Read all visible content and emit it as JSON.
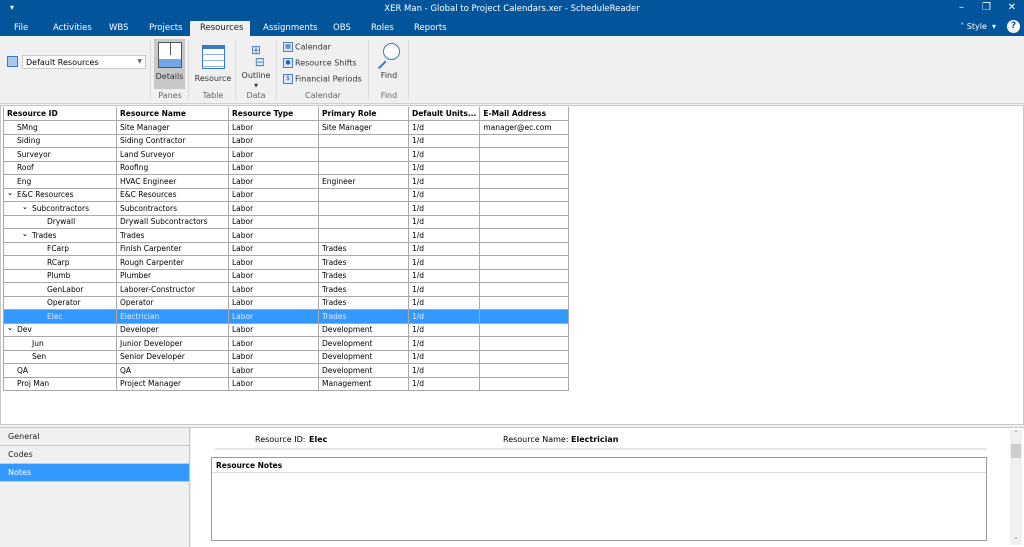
{
  "window": {
    "title": "XER Man - Global to Project Calendars.xer - ScheduleReader",
    "quick_access": "▾",
    "minimize": "–",
    "restore": "❐",
    "close": "✕"
  },
  "menu": {
    "tabs": [
      "File",
      "Activities",
      "WBS",
      "Projects",
      "Resources",
      "Assignments",
      "OBS",
      "Roles",
      "Reports"
    ],
    "active": "Resources",
    "style_label": "Style",
    "help": "?"
  },
  "ribbon": {
    "layout_select": "Default Resources",
    "panes": {
      "details": "Details",
      "group": "Panes"
    },
    "table": {
      "resource": "Resource",
      "group": "Table"
    },
    "data": {
      "outline": "Outline",
      "group": "Data"
    },
    "calendar": {
      "calendar": "Calendar",
      "shifts": "Resource Shifts",
      "financial": "Financial Periods",
      "group": "Calendar"
    },
    "find": {
      "find": "Find",
      "group": "Find"
    }
  },
  "grid": {
    "columns": [
      "Resource ID",
      "Resource Name",
      "Resource Type",
      "Primary Role",
      "Default Units...",
      "E-Mail Address"
    ],
    "rows": [
      {
        "level": 0,
        "exp": false,
        "id": "SMng",
        "name": "Site Manager",
        "type": "Labor",
        "role": "Site Manager",
        "units": "1/d",
        "email": "manager@ec.com"
      },
      {
        "level": 0,
        "exp": false,
        "id": "Siding",
        "name": "Siding Contractor",
        "type": "Labor",
        "role": "",
        "units": "1/d",
        "email": ""
      },
      {
        "level": 0,
        "exp": false,
        "id": "Surveyor",
        "name": "Land Surveyor",
        "type": "Labor",
        "role": "",
        "units": "1/d",
        "email": ""
      },
      {
        "level": 0,
        "exp": false,
        "id": "Roof",
        "name": "Roofing",
        "type": "Labor",
        "role": "",
        "units": "1/d",
        "email": ""
      },
      {
        "level": 0,
        "exp": false,
        "id": "Eng",
        "name": "HVAC Engineer",
        "type": "Labor",
        "role": "Engineer",
        "units": "1/d",
        "email": ""
      },
      {
        "level": 0,
        "exp": true,
        "id": "E&C Resources",
        "name": "E&C Resources",
        "type": "Labor",
        "role": "",
        "units": "1/d",
        "email": ""
      },
      {
        "level": 1,
        "exp": true,
        "id": "Subcontractors",
        "name": "Subcontractors",
        "type": "Labor",
        "role": "",
        "units": "1/d",
        "email": ""
      },
      {
        "level": 2,
        "exp": false,
        "id": "Drywall",
        "name": "Drywall Subcontractors",
        "type": "Labor",
        "role": "",
        "units": "1/d",
        "email": ""
      },
      {
        "level": 1,
        "exp": true,
        "id": "Trades",
        "name": "Trades",
        "type": "Labor",
        "role": "",
        "units": "1/d",
        "email": ""
      },
      {
        "level": 2,
        "exp": false,
        "id": "FCarp",
        "name": "Finish Carpenter",
        "type": "Labor",
        "role": "Trades",
        "units": "1/d",
        "email": ""
      },
      {
        "level": 2,
        "exp": false,
        "id": "RCarp",
        "name": "Rough Carpenter",
        "type": "Labor",
        "role": "Trades",
        "units": "1/d",
        "email": ""
      },
      {
        "level": 2,
        "exp": false,
        "id": "Plumb",
        "name": "Plumber",
        "type": "Labor",
        "role": "Trades",
        "units": "1/d",
        "email": ""
      },
      {
        "level": 2,
        "exp": false,
        "id": "GenLabor",
        "name": "Laborer-Constructor",
        "type": "Labor",
        "role": "Trades",
        "units": "1/d",
        "email": ""
      },
      {
        "level": 2,
        "exp": false,
        "id": "Operator",
        "name": "Operator",
        "type": "Labor",
        "role": "Trades",
        "units": "1/d",
        "email": ""
      },
      {
        "level": 2,
        "exp": false,
        "id": "Elec",
        "name": "Electrician",
        "type": "Labor",
        "role": "Trades",
        "units": "1/d",
        "email": "",
        "selected": true
      },
      {
        "level": 0,
        "exp": true,
        "id": "Dev",
        "name": "Developer",
        "type": "Labor",
        "role": "Development",
        "units": "1/d",
        "email": ""
      },
      {
        "level": 1,
        "exp": false,
        "id": "Jun",
        "name": "Junior Developer",
        "type": "Labor",
        "role": "Development",
        "units": "1/d",
        "email": ""
      },
      {
        "level": 1,
        "exp": false,
        "id": "Sen",
        "name": "Senior Developer",
        "type": "Labor",
        "role": "Development",
        "units": "1/d",
        "email": ""
      },
      {
        "level": 0,
        "exp": false,
        "id": "QA",
        "name": "QA",
        "type": "Labor",
        "role": "Development",
        "units": "1/d",
        "email": ""
      },
      {
        "level": 0,
        "exp": false,
        "id": "Proj Man",
        "name": "Project Manager",
        "type": "Labor",
        "role": "Management",
        "units": "1/d",
        "email": ""
      }
    ]
  },
  "details": {
    "tabs": [
      "General",
      "Codes",
      "Notes"
    ],
    "active": "Notes",
    "resource_id_label": "Resource ID:",
    "resource_id": "Elec",
    "resource_name_label": "Resource Name:",
    "resource_name": "Electrician",
    "notes_header": "Resource Notes",
    "scroll_up": "˄",
    "scroll_down": "˅"
  },
  "colors": {
    "brand": "#03559b",
    "selection": "#3399ff"
  }
}
